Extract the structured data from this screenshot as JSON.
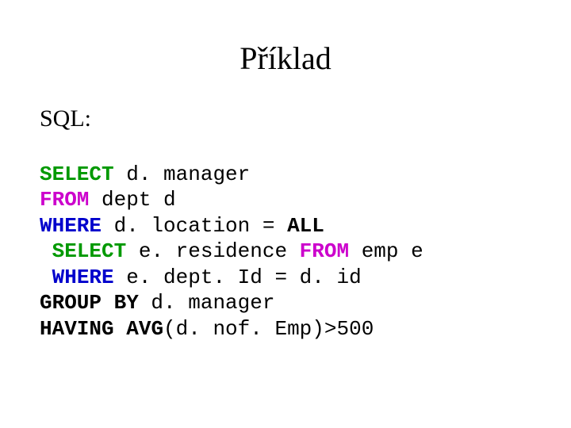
{
  "title": "Příklad",
  "label": "SQL:",
  "code": {
    "l1": {
      "kw": "SELECT",
      "rest": " d. manager"
    },
    "l2": {
      "kw": "FROM",
      "rest": " dept d"
    },
    "l3": {
      "kw": "WHERE",
      "mid": " d. location = ",
      "all": "ALL"
    },
    "l4": {
      "lead": " ",
      "kw1": "SELECT",
      "mid": " e. residence ",
      "kw2": "FROM",
      "rest": " emp e"
    },
    "l5": {
      "lead": " ",
      "kw": "WHERE",
      "rest": " e. dept. Id = d. id"
    },
    "l6": {
      "kw": "GROUP BY",
      "rest": " d. manager"
    },
    "l7": {
      "kw1": "HAVING",
      "sp": " ",
      "kw2": "AVG",
      "rest": "(d. nof. Emp)>500"
    }
  }
}
